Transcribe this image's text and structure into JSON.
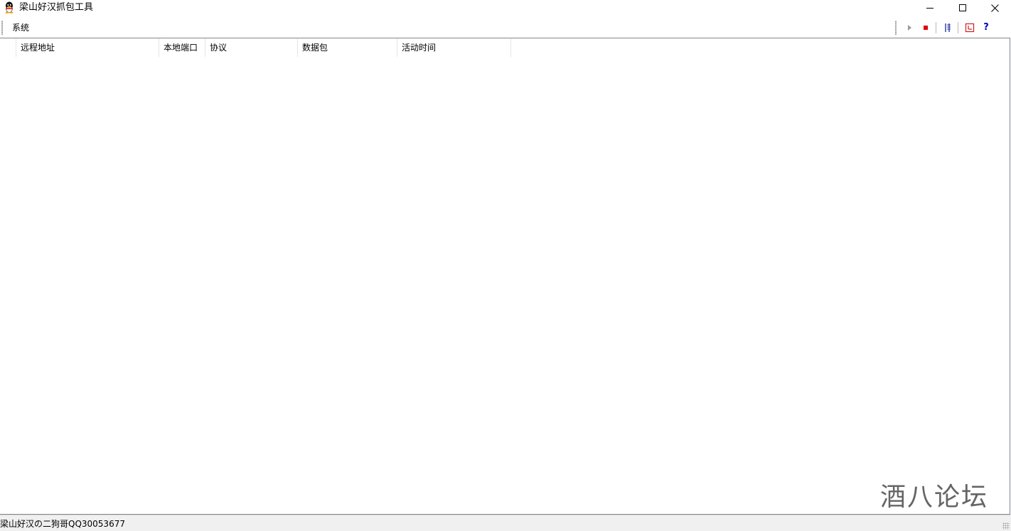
{
  "window": {
    "title": "梁山好汉抓包工具",
    "icon": "penguin-icon"
  },
  "menubar": {
    "items": [
      {
        "label": "系统"
      }
    ]
  },
  "toolbar": {
    "buttons": [
      {
        "name": "start",
        "icon": "play-icon",
        "enabled": false,
        "color": "#9a9a9a"
      },
      {
        "name": "stop",
        "icon": "stop-icon",
        "enabled": true,
        "color": "#e00000"
      },
      {
        "name": "columns",
        "icon": "columns-icon",
        "enabled": true,
        "color": "#2a3aa0"
      },
      {
        "name": "filter",
        "icon": "window-icon",
        "enabled": true,
        "color": "#d02020"
      },
      {
        "name": "help",
        "icon": "help-icon",
        "label": "?",
        "enabled": true,
        "color": "#0000c8"
      }
    ]
  },
  "table": {
    "columns": [
      {
        "label": "远程地址"
      },
      {
        "label": "本地端口"
      },
      {
        "label": "协议"
      },
      {
        "label": "数据包"
      },
      {
        "label": "活动时间"
      }
    ],
    "rows": []
  },
  "watermark": {
    "text": "酒八论坛"
  },
  "statusbar": {
    "text": "梁山好汉の二狗哥QQ30053677"
  }
}
